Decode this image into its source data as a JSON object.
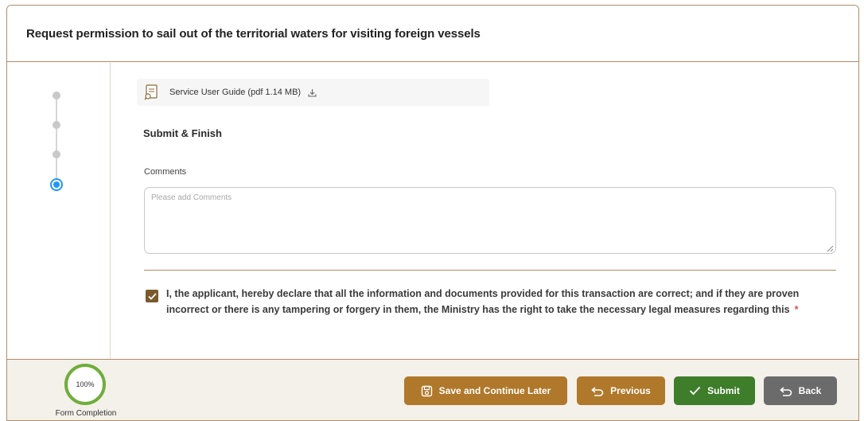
{
  "header": {
    "title": "Request permission to sail out of the territorial waters for visiting foreign vessels"
  },
  "stepper": {
    "steps_total": 4,
    "active_step": 4
  },
  "guide": {
    "label": "Service User Guide (pdf 1.14 MB)",
    "icon": "document-icon",
    "download_icon": "download-icon"
  },
  "form": {
    "section_title": "Submit & Finish",
    "comments_label": "Comments",
    "comments_placeholder": "Please add Comments",
    "comments_value": "",
    "declaration_checked": true,
    "declaration_text": "I, the applicant, hereby declare that all the information and documents provided for this transaction are correct; and if they are proven incorrect or there is any tampering or forgery in them, the Ministry has the right to take the necessary legal measures regarding this",
    "required_marker": "*"
  },
  "footer": {
    "completion_value": "100%",
    "completion_fraction": 1.0,
    "completion_label": "Form Completion",
    "buttons": {
      "save_label": "Save and Continue Later",
      "previous_label": "Previous",
      "submit_label": "Submit",
      "back_label": "Back"
    }
  },
  "colors": {
    "accent_brown": "#b0782a",
    "border_brown": "#b08d63",
    "checkbox_brown": "#7a5a2c",
    "submit_green": "#3e7d2a",
    "back_gray": "#6b6b6b",
    "progress_green": "#6fae3b",
    "active_step_blue": "#2196f3",
    "required_red": "#d9534f"
  }
}
